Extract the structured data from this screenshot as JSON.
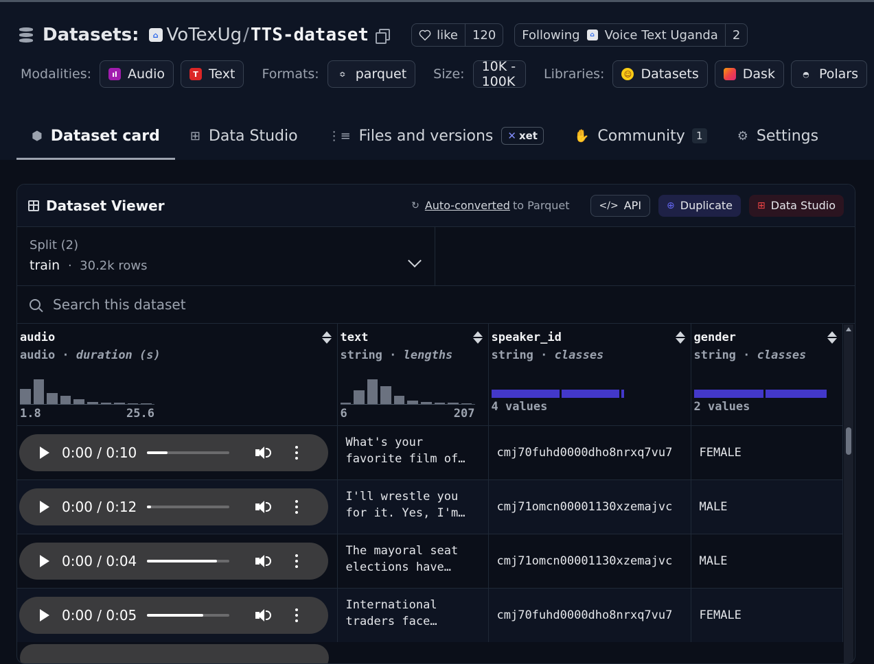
{
  "header": {
    "datasets_label": "Datasets:",
    "org": "VoTexUg",
    "slash": "/",
    "repo": "TTS-dataset",
    "like_label": "like",
    "like_count": "120",
    "following_label": "Following",
    "following_org": "Voice Text Uganda",
    "following_count": "2"
  },
  "tags": {
    "modalities_label": "Modalities:",
    "audio": "Audio",
    "text": "Text",
    "formats_label": "Formats:",
    "parquet": "parquet",
    "size_label": "Size:",
    "size": "10K - 100K",
    "libraries_label": "Libraries:",
    "datasets": "Datasets",
    "dask": "Dask",
    "polars": "Polars"
  },
  "tabs": {
    "dataset_card": "Dataset card",
    "data_studio": "Data Studio",
    "files_versions": "Files and versions",
    "xet": "xet",
    "community": "Community",
    "community_count": "1",
    "settings": "Settings"
  },
  "viewer": {
    "title": "Dataset Viewer",
    "auto_converted": "Auto-converted",
    "to_parquet": "to Parquet",
    "api": "API",
    "duplicate": "Duplicate",
    "data_studio": "Data Studio",
    "split_label": "Split (2)",
    "split_value": "train",
    "split_rows": "30.2k rows",
    "search_placeholder": "Search this dataset"
  },
  "columns": [
    {
      "name": "audio",
      "type": "audio",
      "stat": "duration (s)",
      "min": "1.8",
      "max": "25.6",
      "hist": [
        0.55,
        0.9,
        0.4,
        0.3,
        0.18,
        0.08,
        0.05,
        0.04,
        0.03,
        0.03
      ]
    },
    {
      "name": "text",
      "type": "string",
      "stat": "lengths",
      "min": "6",
      "max": "207",
      "hist": [
        0.05,
        0.5,
        0.9,
        0.65,
        0.3,
        0.12,
        0.08,
        0.05,
        0.04,
        0.03
      ]
    },
    {
      "name": "speaker_id",
      "type": "string",
      "stat": "classes",
      "values": "4 values",
      "classes": [
        0.52,
        0.44,
        0.02
      ]
    },
    {
      "name": "gender",
      "type": "string",
      "stat": "classes",
      "values": "2 values",
      "classes": [
        0.53,
        0.46
      ]
    }
  ],
  "rows": [
    {
      "time": "0:00 / 0:10",
      "progress": 0.25,
      "text": "What's your favorite film of…",
      "speaker_id": "cmj70fuhd0000dho8nrxq7vu7",
      "gender": "FEMALE"
    },
    {
      "time": "0:00 / 0:12",
      "progress": 0.05,
      "text": "I'll wrestle you for it. Yes, I'm…",
      "speaker_id": "cmj71omcn00001130xzemajvc",
      "gender": "MALE"
    },
    {
      "time": "0:00 / 0:04",
      "progress": 0.85,
      "text": "The mayoral seat elections have…",
      "speaker_id": "cmj71omcn00001130xzemajvc",
      "gender": "MALE"
    },
    {
      "time": "0:00 / 0:05",
      "progress": 0.68,
      "text": "International traders face…",
      "speaker_id": "cmj70fuhd0000dho8nrxq7vu7",
      "gender": "FEMALE"
    }
  ],
  "icons": {
    "database": "database-icon",
    "copy": "copy-icon",
    "heart": "heart-icon",
    "search": "search-icon",
    "chevron": "chevron-down-icon"
  },
  "colors": {
    "accent_bar": "#4338ca",
    "hist_bar": "#6b7280",
    "background": "#0b0f19"
  }
}
